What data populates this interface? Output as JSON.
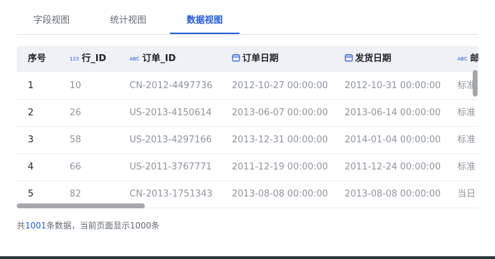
{
  "tabs": [
    {
      "label": "字段视图"
    },
    {
      "label": "统计视图"
    },
    {
      "label": "数据视图",
      "active": true
    }
  ],
  "table": {
    "columns": [
      {
        "label": "序号",
        "type": ""
      },
      {
        "label": "行_ID",
        "type": "123"
      },
      {
        "label": "订单_ID",
        "type": "ABC"
      },
      {
        "label": "订单日期",
        "type": "date"
      },
      {
        "label": "发货日期",
        "type": "date"
      },
      {
        "label": "邮",
        "type": "ABC"
      }
    ],
    "rows": [
      [
        "1",
        "10",
        "CN-2012-4497736",
        "2012-10-27 00:00:00",
        "2012-10-31 00:00:00",
        "标准"
      ],
      [
        "2",
        "26",
        "US-2013-4150614",
        "2013-06-07 00:00:00",
        "2013-06-14 00:00:00",
        "标准"
      ],
      [
        "3",
        "58",
        "US-2013-4297166",
        "2013-12-31 00:00:00",
        "2014-01-04 00:00:00",
        "标准"
      ],
      [
        "4",
        "66",
        "US-2011-3767771",
        "2011-12-19 00:00:00",
        "2011-12-24 00:00:00",
        "标准"
      ],
      [
        "5",
        "82",
        "CN-2013-1751343",
        "2013-08-08 00:00:00",
        "2013-08-08 00:00:00",
        "当日"
      ]
    ]
  },
  "footer": {
    "prefix": "共",
    "total": "1001",
    "suffix": "条数据，当前页面显示1000条"
  },
  "colors": {
    "accent": "#245bdb",
    "header_bg": "#eff1f5",
    "muted_text": "#8f959e"
  }
}
